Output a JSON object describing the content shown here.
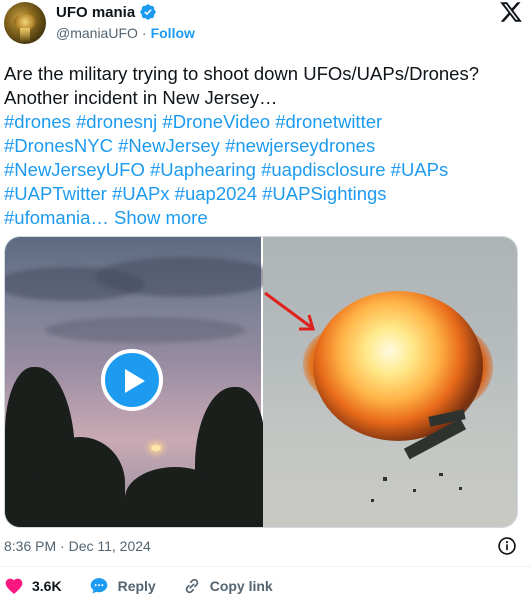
{
  "header": {
    "display_name": "UFO mania",
    "handle": "@maniaUFO",
    "separator": "·",
    "follow_label": "Follow"
  },
  "tweet": {
    "line1": "Are the military trying to shoot down UFOs/UAPs/Drones?",
    "line2": "Another incident in New Jersey…",
    "hashtags_line1": [
      "#drones",
      "#dronesnj",
      "#DroneVideo",
      "#dronetwitter"
    ],
    "hashtags_line2": [
      "#DronesNYC",
      "#NewJersey",
      "#newjerseydrones"
    ],
    "hashtags_line3": [
      "#NewJerseyUFO",
      "#Uaphearing",
      "#uapdisclosure",
      "#UAPs"
    ],
    "hashtags_line4": [
      "#UAPTwitter",
      "#UAPx",
      "#uap2024",
      "#UAPSightings"
    ],
    "last_tag": "#ufomania…",
    "show_more": "Show more"
  },
  "timestamp": "8:36 PM · Dec 11, 2024",
  "actions": {
    "likes": "3.6K",
    "reply_label": "Reply",
    "copy_link_label": "Copy link"
  },
  "colors": {
    "accent": "#1d9bf0",
    "like": "#f91880",
    "text": "#0f1419",
    "muted": "#536471"
  }
}
